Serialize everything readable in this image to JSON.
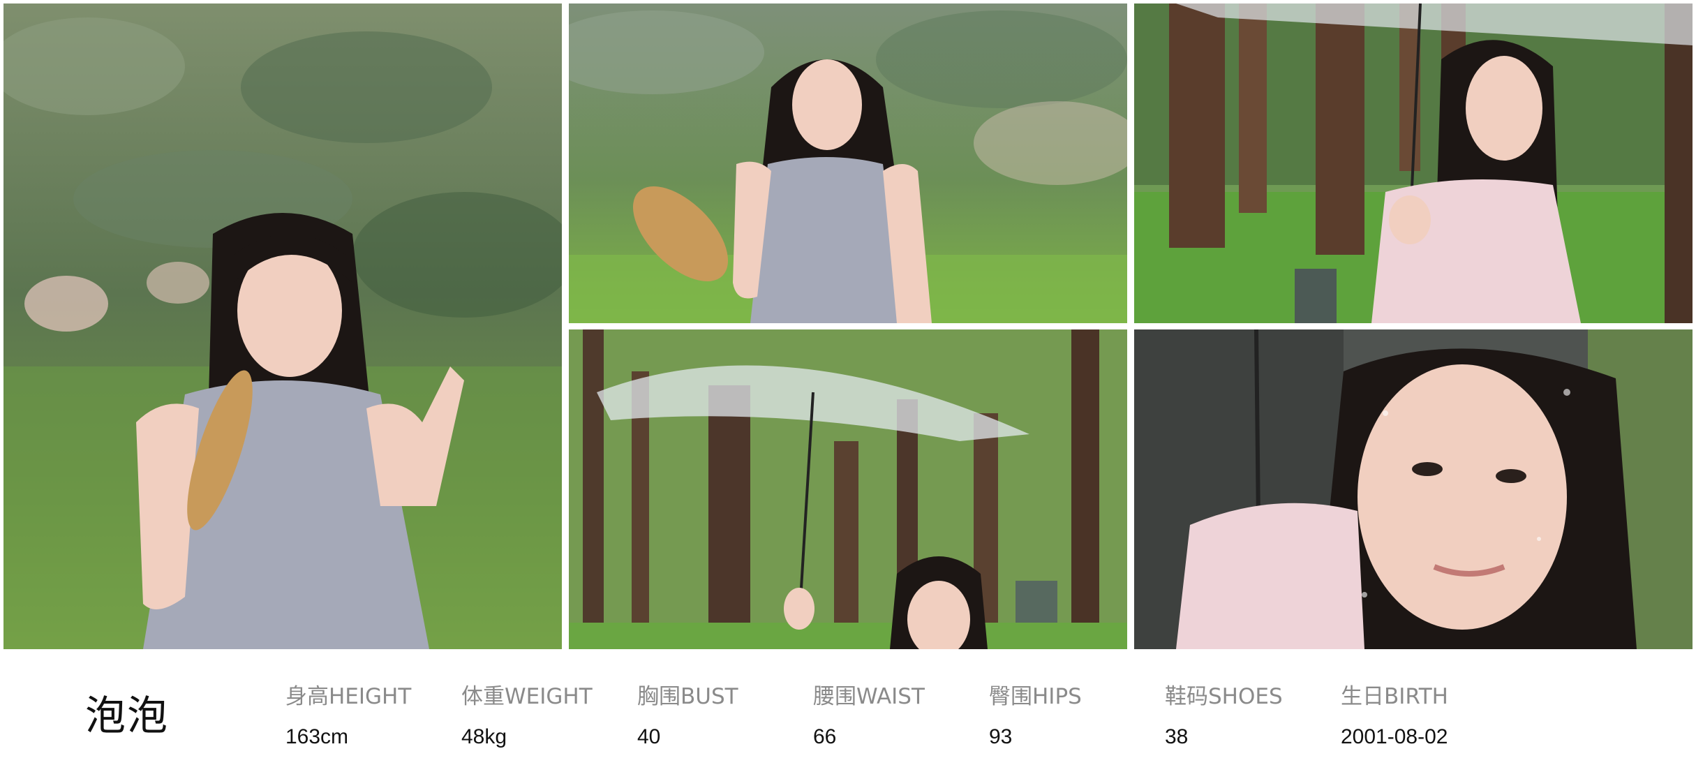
{
  "profile": {
    "name": "泡泡",
    "stats": [
      {
        "label": "身高HEIGHT",
        "value": "163cm"
      },
      {
        "label": "体重WEIGHT",
        "value": "48kg"
      },
      {
        "label": "胸围BUST",
        "value": "40"
      },
      {
        "label": "腰围WAIST",
        "value": "66"
      },
      {
        "label": "臀围HIPS",
        "value": "93"
      },
      {
        "label": "鞋码SHOES",
        "value": "38"
      },
      {
        "label": "生日BIRTH",
        "value": "2001-08-02"
      }
    ]
  },
  "colors": {
    "foliage": "#5f7d4a",
    "grass": "#5f9a3e",
    "dress": "#a5a9b8",
    "pink_top": "#eed3d8",
    "hair": "#1c1614",
    "skin": "#f1cfc0"
  }
}
